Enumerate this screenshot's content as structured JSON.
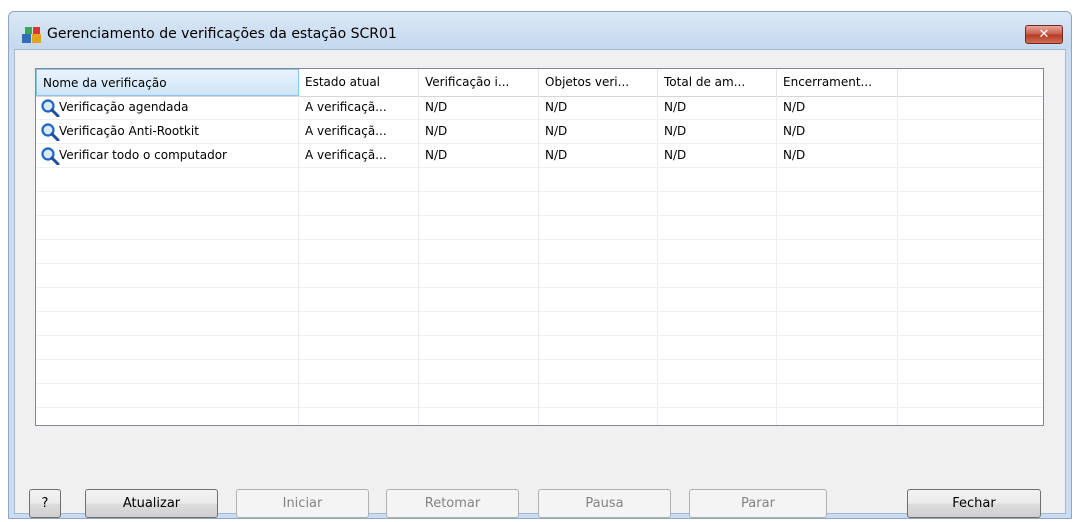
{
  "window": {
    "title": "Gerenciamento de verificações da estação SCR01",
    "close_label": "✕"
  },
  "table": {
    "columns": [
      "Nome da verificação",
      "Estado atual",
      "Verificação i...",
      "Objetos veri...",
      "Total de am...",
      "Encerrament..."
    ],
    "rows": [
      [
        "Verificação agendada",
        "A verificaçã...",
        "N/D",
        "N/D",
        "N/D",
        "N/D"
      ],
      [
        "Verificação Anti-Rootkit",
        "A verificaçã...",
        "N/D",
        "N/D",
        "N/D",
        "N/D"
      ],
      [
        "Verificar todo o computador",
        "A verificaçã...",
        "N/D",
        "N/D",
        "N/D",
        "N/D"
      ]
    ],
    "row_icon": "magnifier-icon"
  },
  "buttons": {
    "help": "?",
    "refresh": "Atualizar",
    "start": "Iniciar",
    "resume": "Retomar",
    "pause": "Pausa",
    "stop": "Parar",
    "close": "Fechar"
  },
  "colors": {
    "titlebar": "#c9dcf1",
    "close_button": "#c75a47",
    "header_active": "#cfe5f7",
    "icon_blue": "#1e64c8"
  }
}
